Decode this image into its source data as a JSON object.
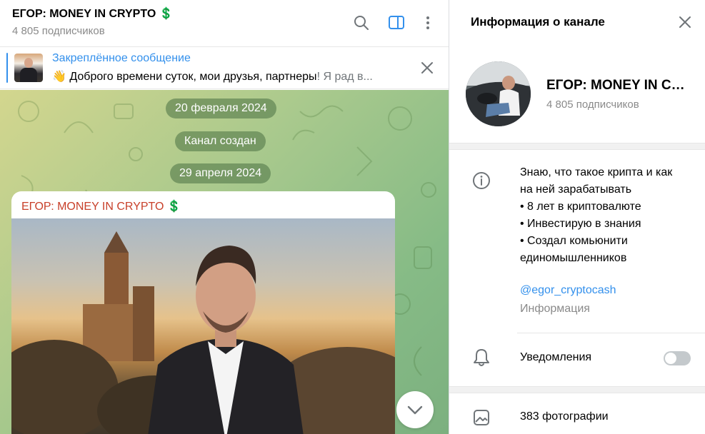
{
  "chat": {
    "title": "ЕГОР: MONEY IN CRYPTO 💲",
    "subscribers": "4 805 подписчиков",
    "pinned": {
      "label": "Закреплённое сообщение",
      "text_main": "👋 Доброго времени суток, мои друзья, партнеры",
      "text_tail": "! Я рад в..."
    },
    "dates": [
      "20 февраля 2024",
      "Канал создан",
      "29 апреля 2024"
    ],
    "post_author": "ЕГОР: MONEY IN CRYPTO 💲"
  },
  "info": {
    "title": "Информация о канале",
    "name": "ЕГОР: MONEY IN CRYPTO 💲",
    "subscribers": "4 805 подписчиков",
    "about_lines": [
      "Знаю, что такое крипта и как",
      "на ней зарабатывать",
      "• 8 лет в криптовалюте",
      "• Инвестирую в знания",
      "• Создал комьюнити",
      "единомышленников"
    ],
    "username": "@egor_cryptocash",
    "username_caption": "Информация",
    "notifications_label": "Уведомления",
    "notifications_on": false,
    "photos_label": "383 фотографии"
  },
  "icons": {
    "search": "search-icon",
    "sidebar": "sidebar-toggle-icon",
    "more": "more-vertical-icon",
    "close": "close-icon",
    "info": "info-icon",
    "bell": "bell-icon",
    "photo": "photo-icon",
    "chevron": "chevron-down-icon"
  },
  "colors": {
    "accent": "#3390ec",
    "author": "#c8402a"
  }
}
